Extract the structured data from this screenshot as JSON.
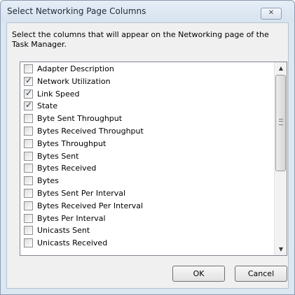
{
  "dialog": {
    "title": "Select Networking Page Columns",
    "close_icon": "close-icon",
    "description": "Select the columns that will appear on the Networking page of the Task Manager."
  },
  "columns": [
    {
      "label": "Adapter Description",
      "checked": false
    },
    {
      "label": "Network Utilization",
      "checked": true
    },
    {
      "label": "Link Speed",
      "checked": true
    },
    {
      "label": "State",
      "checked": true
    },
    {
      "label": "Byte Sent Throughput",
      "checked": false
    },
    {
      "label": "Bytes Received Throughput",
      "checked": false
    },
    {
      "label": "Bytes Throughput",
      "checked": false
    },
    {
      "label": "Bytes Sent",
      "checked": false
    },
    {
      "label": "Bytes Received",
      "checked": false
    },
    {
      "label": "Bytes",
      "checked": false
    },
    {
      "label": "Bytes Sent Per Interval",
      "checked": false
    },
    {
      "label": "Bytes Received Per Interval",
      "checked": false
    },
    {
      "label": "Bytes Per Interval",
      "checked": false
    },
    {
      "label": "Unicasts Sent",
      "checked": false
    },
    {
      "label": "Unicasts Received",
      "checked": false
    }
  ],
  "scrollbar": {
    "up_icon": "scroll-up-arrow-icon",
    "down_icon": "scroll-down-arrow-icon",
    "grip_icon": "scroll-grip-icon"
  },
  "buttons": {
    "ok": "OK",
    "cancel": "Cancel"
  },
  "colors": {
    "frame": "#dde7f1",
    "client": "#f0f0f0",
    "list_background": "#ffffff",
    "check_mark": "#2d3f57"
  }
}
